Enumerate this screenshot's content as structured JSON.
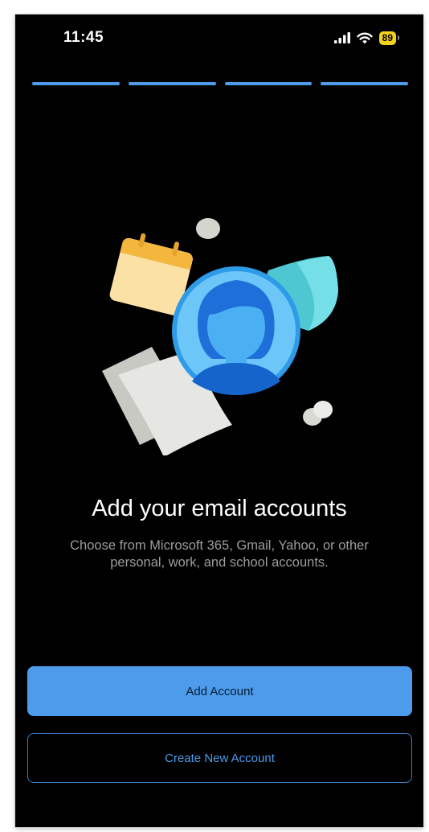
{
  "status_bar": {
    "time": "11:45",
    "battery": "89",
    "icons": [
      "signal-icon",
      "wifi-icon",
      "battery-icon"
    ]
  },
  "onboarding": {
    "progress_steps": 4,
    "title": "Add your email accounts",
    "subtitle": "Choose from Microsoft 365, Gmail, Yahoo, or other personal, work, and school accounts."
  },
  "actions": {
    "add_account_label": "Add Account",
    "create_account_label": "Create New Account"
  },
  "colors": {
    "accent": "#4d9bea",
    "background": "#000000",
    "battery": "#f2d21a"
  }
}
